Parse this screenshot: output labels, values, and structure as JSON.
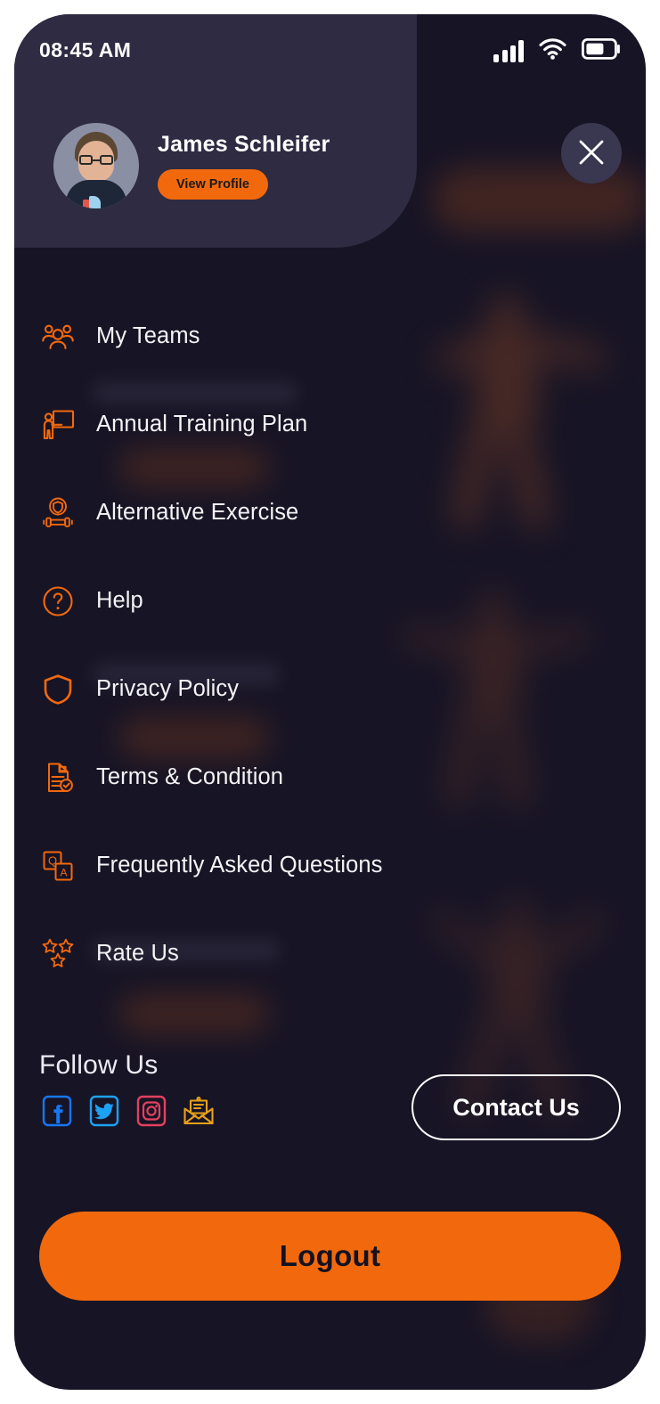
{
  "status_bar": {
    "time": "08:45 AM",
    "cellular_icon": "signal-bars-icon",
    "wifi_icon": "wifi-icon",
    "battery_icon": "battery-icon",
    "battery_level_percent": 60
  },
  "header": {
    "avatar_alt": "James Schleifer profile photo",
    "name": "James Schleifer",
    "view_profile_label": "View Profile",
    "close_label": "Close",
    "panel_color": "#2E2B42"
  },
  "menu": {
    "items": [
      {
        "label": "My Teams",
        "icon": "users-group-icon"
      },
      {
        "label": "Annual Training Plan",
        "icon": "presenter-board-icon"
      },
      {
        "label": "Alternative Exercise",
        "icon": "shield-dumbbell-icon"
      },
      {
        "label": "Help",
        "icon": "question-circle-icon"
      },
      {
        "label": "Privacy Policy",
        "icon": "shield-icon"
      },
      {
        "label": "Terms & Condition",
        "icon": "document-check-icon"
      },
      {
        "label": "Frequently Asked Questions",
        "icon": "qa-blocks-icon"
      },
      {
        "label": "Rate Us",
        "icon": "three-stars-icon"
      }
    ]
  },
  "follow": {
    "title": "Follow Us",
    "socials": [
      {
        "name": "facebook-icon",
        "color": "#1877F2"
      },
      {
        "name": "twitter-icon",
        "color": "#1DA1F2"
      },
      {
        "name": "instagram-icon",
        "color": "#E4405F"
      },
      {
        "name": "email-icon",
        "color": "#E8A117"
      }
    ]
  },
  "contact": {
    "label": "Contact Us"
  },
  "logout": {
    "label": "Logout"
  },
  "colors": {
    "background": "#171425",
    "accent_orange": "#F2690D",
    "text_primary": "#F4F4F6",
    "frame": "#FFFFFF"
  }
}
